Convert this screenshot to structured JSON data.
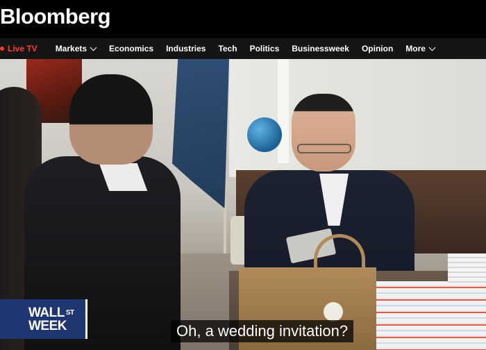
{
  "header": {
    "logo": "Bloomberg"
  },
  "nav": {
    "live_label": "Live TV",
    "items": [
      {
        "label": "Markets",
        "has_dropdown": true
      },
      {
        "label": "Economics",
        "has_dropdown": false
      },
      {
        "label": "Industries",
        "has_dropdown": false
      },
      {
        "label": "Tech",
        "has_dropdown": false
      },
      {
        "label": "Politics",
        "has_dropdown": false
      },
      {
        "label": "Businessweek",
        "has_dropdown": false
      },
      {
        "label": "Opinion",
        "has_dropdown": false
      },
      {
        "label": "More",
        "has_dropdown": true
      }
    ]
  },
  "video": {
    "show_badge": {
      "line1": "WALL",
      "superscript": "ST",
      "line2": "WEEK"
    },
    "subtitle": "Oh, a wedding invitation?"
  },
  "colors": {
    "live": "#ff3b2f",
    "badge_bg": "#1f3670",
    "nav_bg": "#151515"
  }
}
